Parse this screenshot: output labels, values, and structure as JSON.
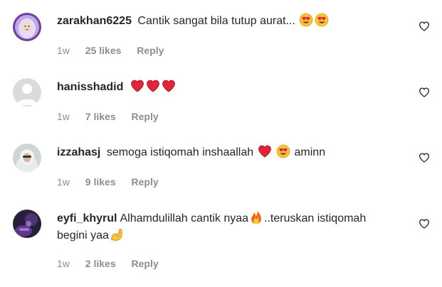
{
  "comments": [
    {
      "username": "zarakhan6225",
      "text": "Cantik sangat bila tutup aurat...",
      "time": "1w",
      "likes": "25 likes",
      "reply": "Reply",
      "emojis": [
        "heart-eyes-emoji",
        "heart-eyes-emoji"
      ]
    },
    {
      "username": "hanisshadid",
      "text": "",
      "time": "1w",
      "likes": "7 likes",
      "reply": "Reply",
      "emojis": [
        "red-heart-emoji",
        "red-heart-emoji",
        "red-heart-emoji"
      ]
    },
    {
      "username": "izzahasj",
      "text_before": "semoga istiqomah inshaallah",
      "text_after": "aminn",
      "time": "1w",
      "likes": "9 likes",
      "reply": "Reply",
      "emojis": [
        "red-heart-emoji",
        "heart-eyes-emoji"
      ]
    },
    {
      "username": "eyfi_khyrul",
      "text_before": "Alhamdulillah cantik nyaa",
      "text_middle": "..teruskan istiqomah",
      "text_line2": "begini yaa",
      "time": "1w",
      "likes": "2 likes",
      "reply": "Reply",
      "emojis": [
        "fire-emoji",
        "flexed-biceps-emoji"
      ]
    }
  ],
  "colors": {
    "text": "#262626",
    "secondary": "#8e8e8e",
    "heart_emoji": "#e0243a",
    "face_emoji": "#f7c33c"
  }
}
